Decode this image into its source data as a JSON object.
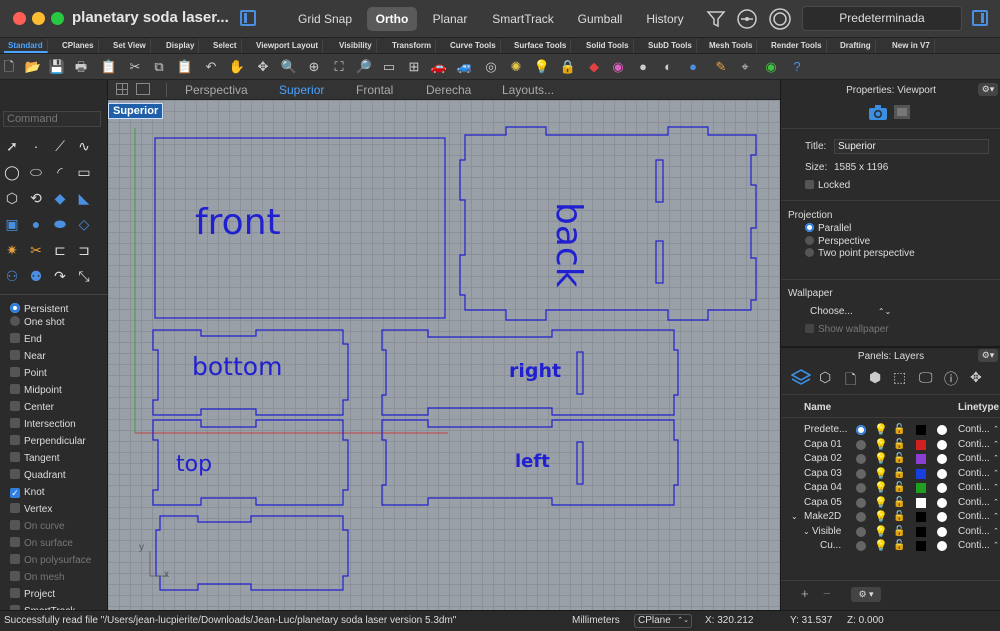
{
  "window": {
    "title": "planetary soda laser...",
    "buttons": [
      "Grid Snap",
      "Ortho",
      "Planar",
      "SmartTrack",
      "Gumball",
      "History"
    ],
    "active_button": "Ortho",
    "layer_dropdown": "Predeterminada"
  },
  "tabs": [
    "Standard",
    "CPlanes",
    "Set View",
    "Display",
    "Select",
    "Viewport Layout",
    "Visibility",
    "Transform",
    "Curve Tools",
    "Surface Tools",
    "Solid Tools",
    "SubD Tools",
    "Mesh Tools",
    "Render Tools",
    "Drafting",
    "New in V7"
  ],
  "active_tab": "Standard",
  "command": {
    "placeholder": "Command"
  },
  "osnaps": {
    "persistent": "Persistent",
    "one_shot": "One shot",
    "items": [
      {
        "label": "End",
        "checked": false,
        "dim": false
      },
      {
        "label": "Near",
        "checked": false,
        "dim": false
      },
      {
        "label": "Point",
        "checked": false,
        "dim": false
      },
      {
        "label": "Midpoint",
        "checked": false,
        "dim": false
      },
      {
        "label": "Center",
        "checked": false,
        "dim": false
      },
      {
        "label": "Intersection",
        "checked": false,
        "dim": false
      },
      {
        "label": "Perpendicular",
        "checked": false,
        "dim": false
      },
      {
        "label": "Tangent",
        "checked": false,
        "dim": false
      },
      {
        "label": "Quadrant",
        "checked": false,
        "dim": false
      },
      {
        "label": "Knot",
        "checked": true,
        "dim": false
      },
      {
        "label": "Vertex",
        "checked": false,
        "dim": false
      },
      {
        "label": "On curve",
        "checked": false,
        "dim": true
      },
      {
        "label": "On surface",
        "checked": false,
        "dim": true
      },
      {
        "label": "On polysurface",
        "checked": false,
        "dim": true
      },
      {
        "label": "On mesh",
        "checked": false,
        "dim": true
      },
      {
        "label": "Project",
        "checked": false,
        "dim": false
      },
      {
        "label": "SmartTrack",
        "checked": false,
        "dim": false
      }
    ]
  },
  "viewport_tabs": [
    "Perspectiva",
    "Superior",
    "Frontal",
    "Derecha",
    "Layouts..."
  ],
  "active_viewport_tab": "Superior",
  "viewport": {
    "label": "Superior",
    "part_labels": [
      "front",
      "back",
      "bottom",
      "right",
      "top",
      "left"
    ],
    "axis_x": "x",
    "axis_y": "y",
    "curve_color": "#2020d0"
  },
  "properties": {
    "header": "Properties: Viewport",
    "title_label": "Title:",
    "title_value": "Superior",
    "size_label": "Size:",
    "size_value": "1585 x 1196",
    "locked_label": "Locked",
    "projection_header": "Projection",
    "projection_options": [
      "Parallel",
      "Perspective",
      "Two point perspective"
    ],
    "projection_selected": "Parallel",
    "wallpaper_header": "Wallpaper",
    "wallpaper_choose": "Choose...",
    "show_wallpaper": "Show wallpaper"
  },
  "layers": {
    "header": "Panels: Layers",
    "col_name": "Name",
    "col_linetype": "Linetype",
    "rows": [
      {
        "name": "Predete...",
        "color": "#000000",
        "linetype": "Conti...",
        "current": true
      },
      {
        "name": "Capa 01",
        "color": "#d02020",
        "linetype": "Conti...",
        "current": false
      },
      {
        "name": "Capa 02",
        "color": "#8a3fd0",
        "linetype": "Conti...",
        "current": false
      },
      {
        "name": "Capa 03",
        "color": "#1a3fe0",
        "linetype": "Conti...",
        "current": false
      },
      {
        "name": "Capa 04",
        "color": "#20a020",
        "linetype": "Conti...",
        "current": false
      },
      {
        "name": "Capa 05",
        "color": "#ffffff",
        "linetype": "Conti...",
        "current": false
      },
      {
        "name": "Make2D",
        "color": "#000000",
        "linetype": "Conti...",
        "current": false
      },
      {
        "name": "Visible",
        "color": "#000000",
        "linetype": "Conti...",
        "current": false
      },
      {
        "name": "Cu...",
        "color": "#000000",
        "linetype": "Conti...",
        "current": false
      }
    ]
  },
  "status": {
    "message": "Successfully read file \"/Users/jean-lucpierite/Downloads/Jean-Luc/planetary soda laser version 5.3dm\"",
    "units": "Millimeters",
    "cplane": "CPlane",
    "x": "X: 320.212",
    "y": "Y: 31.537",
    "z": "Z: 0.000"
  }
}
